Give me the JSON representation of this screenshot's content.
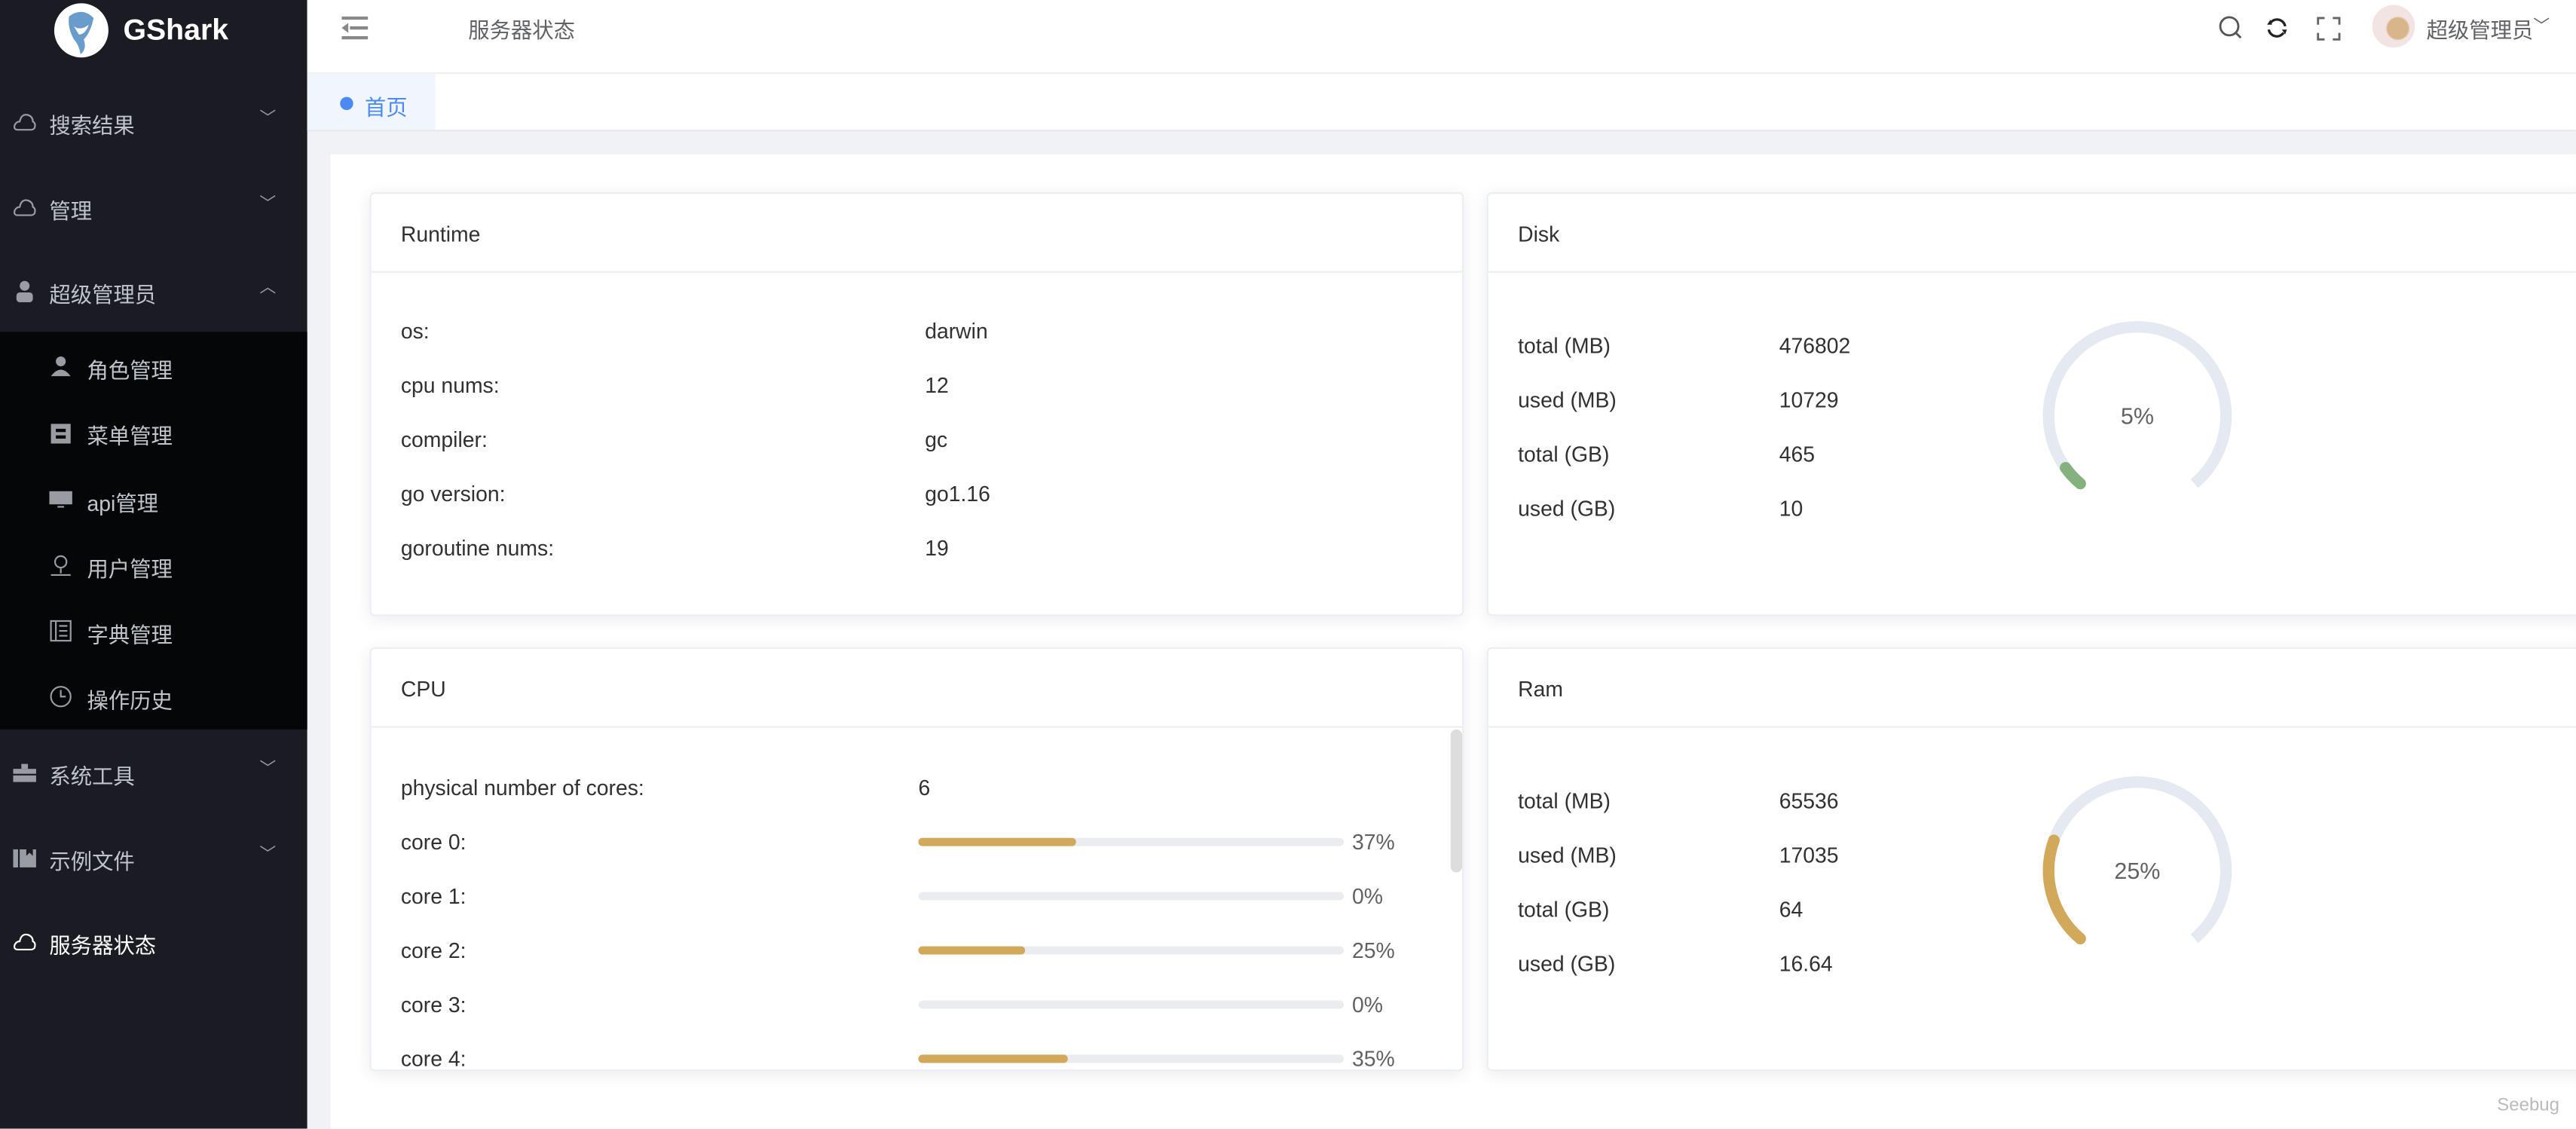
{
  "sidebar": {
    "brand": "GShark",
    "items": [
      {
        "label": "搜索结果",
        "icon": "cloud-icon"
      },
      {
        "label": "管理",
        "icon": "cloud-icon"
      },
      {
        "label": "超级管理员",
        "icon": "user-icon"
      },
      {
        "label": "系统工具",
        "icon": "toolbox-icon"
      },
      {
        "label": "示例文件",
        "icon": "files-icon"
      },
      {
        "label": "服务器状态",
        "icon": "cloud-icon"
      }
    ],
    "subitems": [
      {
        "label": "角色管理",
        "icon": "user-icon"
      },
      {
        "label": "菜单管理",
        "icon": "clipboard-icon"
      },
      {
        "label": "api管理",
        "icon": "monitor-icon"
      },
      {
        "label": "用户管理",
        "icon": "person-outline-icon"
      },
      {
        "label": "字典管理",
        "icon": "book-icon"
      },
      {
        "label": "操作历史",
        "icon": "clock-icon"
      }
    ]
  },
  "header": {
    "title": "服务器状态",
    "user": "超级管理员"
  },
  "tabs": [
    {
      "label": "首页"
    }
  ],
  "runtime": {
    "title": "Runtime",
    "rows": [
      {
        "label": "os:",
        "value": "darwin"
      },
      {
        "label": "cpu nums:",
        "value": "12"
      },
      {
        "label": "compiler:",
        "value": "gc"
      },
      {
        "label": "go version:",
        "value": "go1.16"
      },
      {
        "label": "goroutine nums:",
        "value": "19"
      }
    ]
  },
  "disk": {
    "title": "Disk",
    "rows": [
      {
        "label": "total (MB)",
        "value": "476802"
      },
      {
        "label": "used (MB)",
        "value": "10729"
      },
      {
        "label": "total (GB)",
        "value": "465"
      },
      {
        "label": "used (GB)",
        "value": "10"
      }
    ],
    "percent": 5,
    "percent_label": "5%",
    "color": "#85b17f"
  },
  "cpu": {
    "title": "CPU",
    "physical_label": "physical number of cores:",
    "physical_value": "6",
    "cores": [
      {
        "label": "core 0:",
        "percent": 37,
        "percent_label": "37%"
      },
      {
        "label": "core 1:",
        "percent": 0,
        "percent_label": "0%"
      },
      {
        "label": "core 2:",
        "percent": 25,
        "percent_label": "25%"
      },
      {
        "label": "core 3:",
        "percent": 0,
        "percent_label": "0%"
      },
      {
        "label": "core 4:",
        "percent": 35,
        "percent_label": "35%"
      }
    ],
    "color": "#d2a85b"
  },
  "ram": {
    "title": "Ram",
    "rows": [
      {
        "label": "total (MB)",
        "value": "65536"
      },
      {
        "label": "used (MB)",
        "value": "17035"
      },
      {
        "label": "total (GB)",
        "value": "64"
      },
      {
        "label": "used (GB)",
        "value": "16.64"
      }
    ],
    "percent": 25,
    "percent_label": "25%",
    "color": "#d2a85b"
  },
  "watermark": "Seebug"
}
